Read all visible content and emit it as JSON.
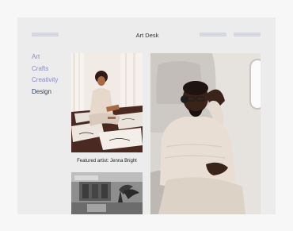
{
  "header": {
    "brand": "Art Desk"
  },
  "sidebar": {
    "items": [
      {
        "label": "Art"
      },
      {
        "label": "Crafts"
      },
      {
        "label": "Creativity"
      },
      {
        "label": "Design"
      }
    ],
    "active_index": 3
  },
  "featured": {
    "caption": "Featured artist: Jenna Bright"
  },
  "colors": {
    "background": "#ececec",
    "nav_placeholder": "#d5d8e3",
    "sidebar_link": "#8a8dbd",
    "sidebar_active": "#2e3b63"
  }
}
